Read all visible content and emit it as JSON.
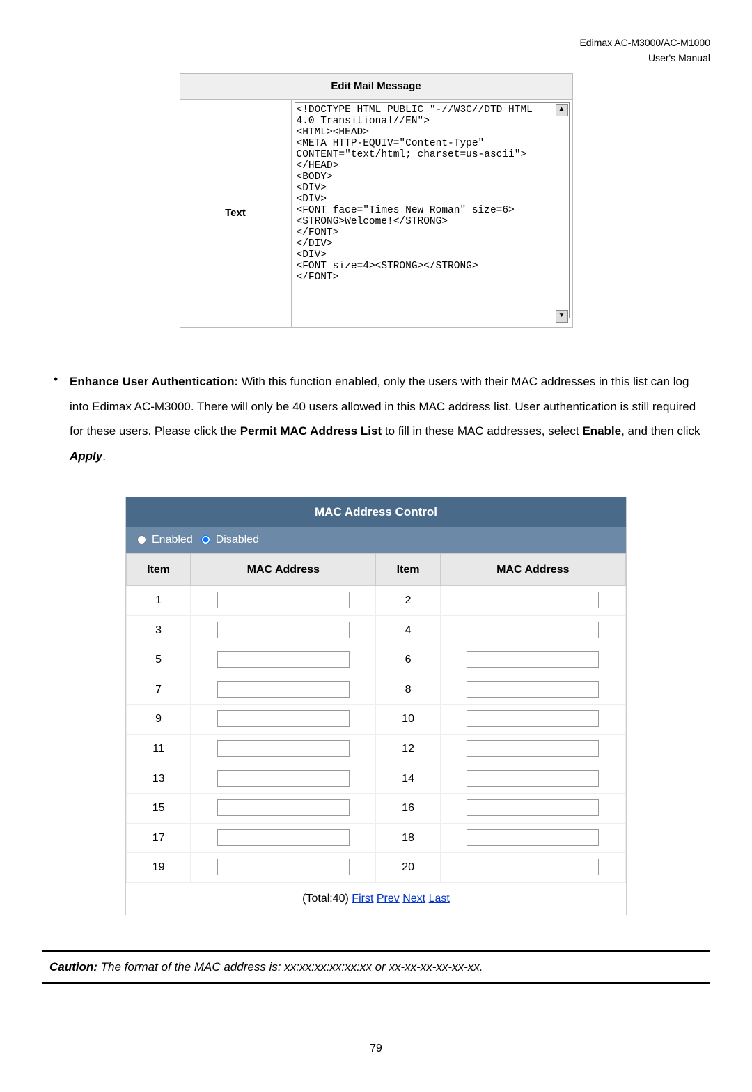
{
  "header": {
    "product": "Edimax AC-M3000/AC-M1000",
    "docType": "User's Manual"
  },
  "editMail": {
    "title": "Edit Mail Message",
    "label": "Text",
    "content": "<!DOCTYPE HTML PUBLIC \"-//W3C//DTD HTML\n4.0 Transitional//EN\">\n<HTML><HEAD>\n<META HTTP-EQUIV=\"Content-Type\"\nCONTENT=\"text/html; charset=us-ascii\">\n</HEAD>\n<BODY>\n<DIV>\n<DIV>\n<FONT face=\"Times New Roman\" size=6>\n<STRONG>Welcome!</STRONG>\n</FONT>\n</DIV>\n<DIV>\n<FONT size=4><STRONG></STRONG>\n</FONT>"
  },
  "paragraph": {
    "lead": "Enhance User Authentication:",
    "body1": " With this function enabled, only the users with their MAC addresses in this list can log into Edimax AC-M3000. There will only be 40 users allowed in this MAC address list. User authentication is still required for these users. Please click the ",
    "strong1": "Permit MAC Address List",
    "body2": " to fill in these MAC addresses, select ",
    "strong2": "Enable",
    "body3": ", and then click ",
    "strong3": "Apply",
    "body4": "."
  },
  "macControl": {
    "title": "MAC Address Control",
    "enabledLabel": "Enabled",
    "disabledLabel": "Disabled",
    "colItem": "Item",
    "colMac": "MAC Address",
    "rows": [
      {
        "a": "1",
        "b": "2"
      },
      {
        "a": "3",
        "b": "4"
      },
      {
        "a": "5",
        "b": "6"
      },
      {
        "a": "7",
        "b": "8"
      },
      {
        "a": "9",
        "b": "10"
      },
      {
        "a": "11",
        "b": "12"
      },
      {
        "a": "13",
        "b": "14"
      },
      {
        "a": "15",
        "b": "16"
      },
      {
        "a": "17",
        "b": "18"
      },
      {
        "a": "19",
        "b": "20"
      }
    ],
    "paging": {
      "total": "(Total:40) ",
      "first": "First",
      "prev": "Prev",
      "next": "Next",
      "last": "Last"
    }
  },
  "caution": {
    "label": "Caution:",
    "text": " The format of the MAC address is: xx:xx:xx:xx:xx:xx or xx-xx-xx-xx-xx-xx."
  },
  "pageNumber": "79"
}
